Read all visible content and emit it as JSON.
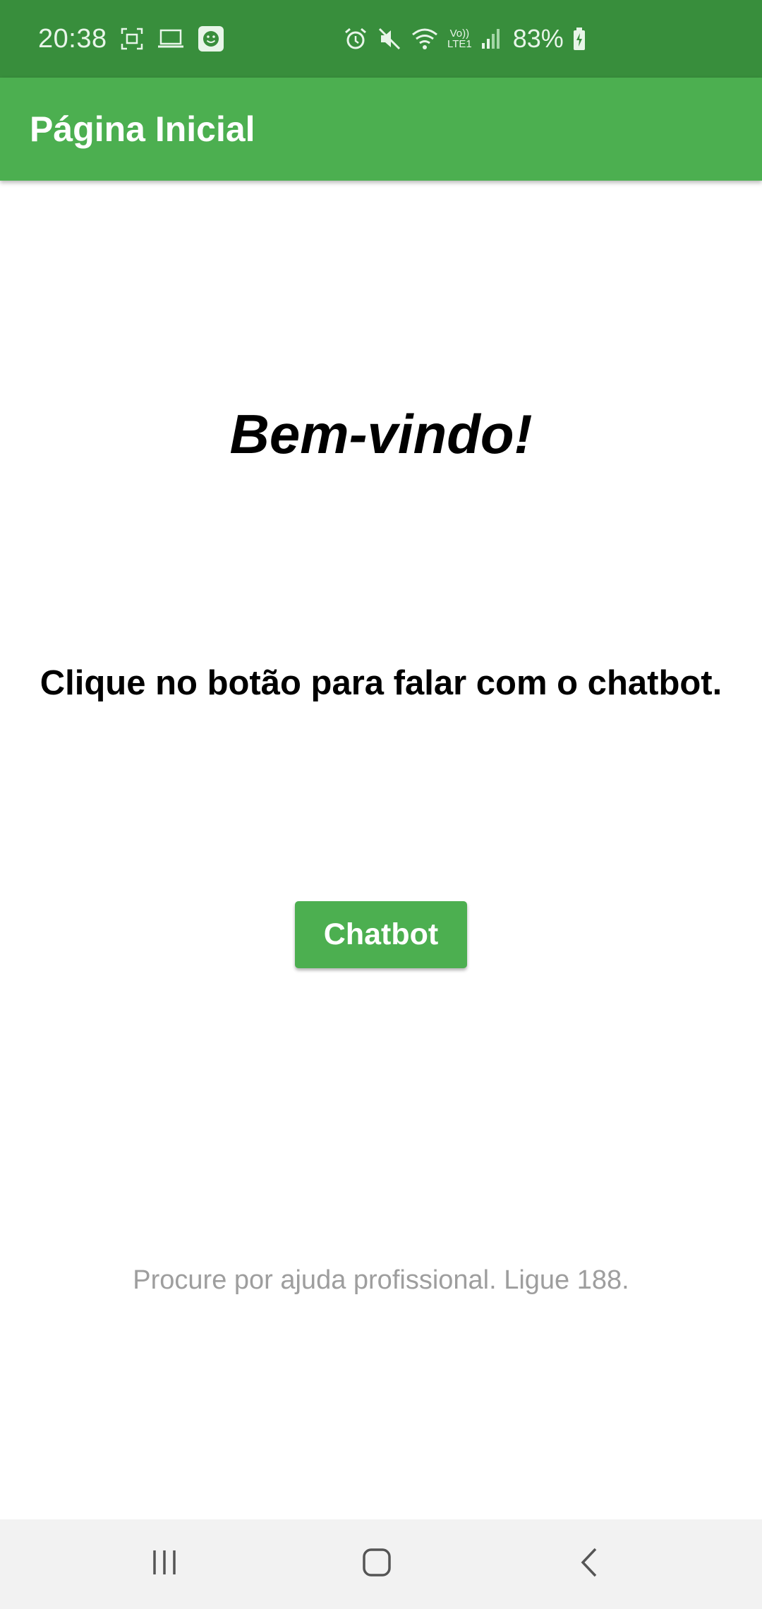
{
  "status_bar": {
    "time": "20:38",
    "battery": "83%",
    "left_icons": [
      "screenshot-icon",
      "laptop-icon",
      "smiley-app-icon"
    ],
    "right_icons": [
      "alarm-icon",
      "mute-icon",
      "wifi-icon",
      "volte-icon",
      "signal-icon",
      "battery-charging-icon"
    ],
    "volte_label": "Vo))",
    "lte_label": "LTE1",
    "color": "#388E3C"
  },
  "app_bar": {
    "title": "Página Inicial",
    "color": "#4CAF50"
  },
  "main": {
    "welcome": "Bem-vindo!",
    "instruction": "Clique no botão para falar com o chatbot.",
    "chatbot_button_label": "Chatbot",
    "footer_note": "Procure por ajuda profissional. Ligue 188."
  },
  "nav_bar": {
    "buttons": [
      "recent-apps-icon",
      "home-icon",
      "back-icon"
    ]
  }
}
